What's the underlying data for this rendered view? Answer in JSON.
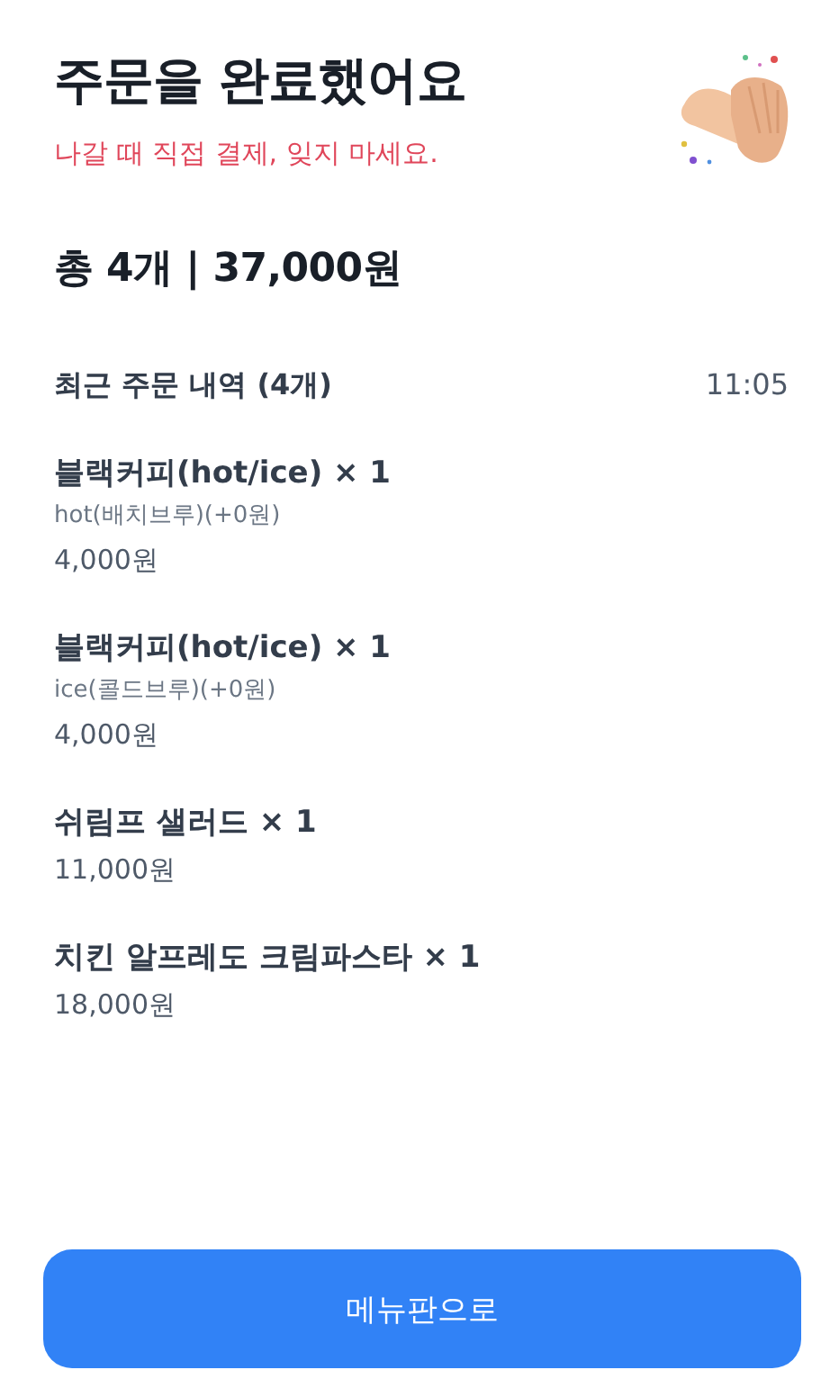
{
  "header": {
    "title": "주문을 완료했어요",
    "notice": "나갈 때 직접 결제, 잊지 마세요."
  },
  "summary": "총 4개 | 37,000원",
  "recent_orders": {
    "title": "최근 주문 내역 (4개)",
    "time": "11:05",
    "items": [
      {
        "name": "블랙커피(hot/ice) × 1",
        "option": "hot(배치브루)(+0원)",
        "price": "4,000원"
      },
      {
        "name": "블랙커피(hot/ice) × 1",
        "option": "ice(콜드브루)(+0원)",
        "price": "4,000원"
      },
      {
        "name": "쉬림프 샐러드 × 1",
        "price": "11,000원"
      },
      {
        "name": "치킨 알프레도 크림파스타 × 1",
        "price": "18,000원"
      }
    ]
  },
  "button": "메뉴판으로"
}
